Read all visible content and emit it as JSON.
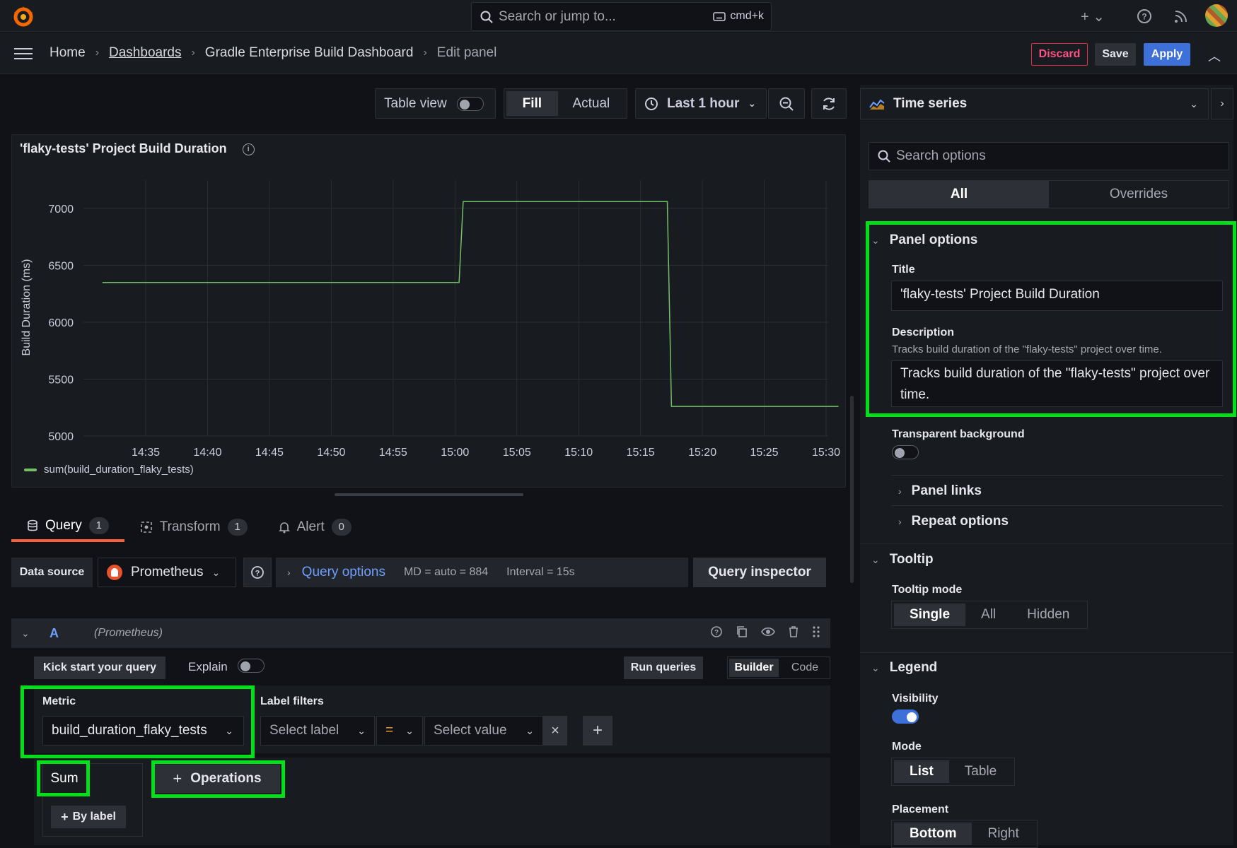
{
  "topbar": {
    "search_placeholder": "Search or jump to...",
    "shortcut": "cmd+k"
  },
  "breadcrumb": {
    "home": "Home",
    "dashboards": "Dashboards",
    "dashboard": "Gradle Enterprise Build Dashboard",
    "current": "Edit panel"
  },
  "actions": {
    "discard": "Discard",
    "save": "Save",
    "apply": "Apply"
  },
  "toolbar": {
    "table_view": "Table view",
    "fill": "Fill",
    "actual": "Actual",
    "time_range": "Last 1 hour"
  },
  "panel": {
    "title": "'flaky-tests' Project Build Duration",
    "legend": "sum(build_duration_flaky_tests)"
  },
  "chart_data": {
    "type": "line",
    "ylabel": "Build Duration (ms)",
    "xlabel": "",
    "x_ticks": [
      "14:35",
      "14:40",
      "14:45",
      "14:50",
      "14:55",
      "15:00",
      "15:05",
      "15:10",
      "15:15",
      "15:20",
      "15:25",
      "15:30"
    ],
    "y_ticks": [
      5000,
      5500,
      6000,
      6500,
      7000
    ],
    "ylim": [
      5000,
      7200
    ],
    "series": [
      {
        "name": "sum(build_duration_flaky_tests)",
        "color": "#73bf69",
        "points": [
          {
            "x": "14:31:30",
            "y": 6350
          },
          {
            "x": "15:00:20",
            "y": 6350
          },
          {
            "x": "15:00:40",
            "y": 7060
          },
          {
            "x": "15:17:10",
            "y": 7060
          },
          {
            "x": "15:17:30",
            "y": 5260
          },
          {
            "x": "15:31:00",
            "y": 5260
          }
        ]
      }
    ]
  },
  "query_tabs": [
    {
      "label": "Query",
      "count": "1"
    },
    {
      "label": "Transform",
      "count": "1"
    },
    {
      "label": "Alert",
      "count": "0"
    }
  ],
  "query": {
    "datasource_label": "Data source",
    "datasource": "Prometheus",
    "options_label": "Query options",
    "md": "MD = auto = 884",
    "interval": "Interval = 15s",
    "inspector": "Query inspector",
    "ref": "A",
    "ref_ds": "(Prometheus)",
    "kickstart": "Kick start your query",
    "explain": "Explain",
    "run": "Run queries",
    "builder": "Builder",
    "code": "Code",
    "metric_label": "Metric",
    "metric": "build_duration_flaky_tests",
    "label_filters": "Label filters",
    "select_label": "Select label",
    "op": "=",
    "select_value": "Select value",
    "sum": "Sum",
    "by_label": "By label",
    "operations": "Operations"
  },
  "options": {
    "viz": "Time series",
    "search_placeholder": "Search options",
    "tab_all": "All",
    "tab_overrides": "Overrides",
    "panel_options": "Panel options",
    "title_label": "Title",
    "title_value": "'flaky-tests' Project Build Duration",
    "description_label": "Description",
    "description_help": "Tracks build duration of the \"flaky-tests\" project over time.",
    "description_value": "Tracks build duration of the \"flaky-tests\" project over time.",
    "transparent": "Transparent background",
    "panel_links": "Panel links",
    "repeat_options": "Repeat options",
    "tooltip": "Tooltip",
    "tooltip_mode": "Tooltip mode",
    "tooltip_modes": [
      "Single",
      "All",
      "Hidden"
    ],
    "legend": "Legend",
    "visibility": "Visibility",
    "mode": "Mode",
    "modes": [
      "List",
      "Table"
    ],
    "placement": "Placement",
    "placements": [
      "Bottom",
      "Right"
    ]
  }
}
